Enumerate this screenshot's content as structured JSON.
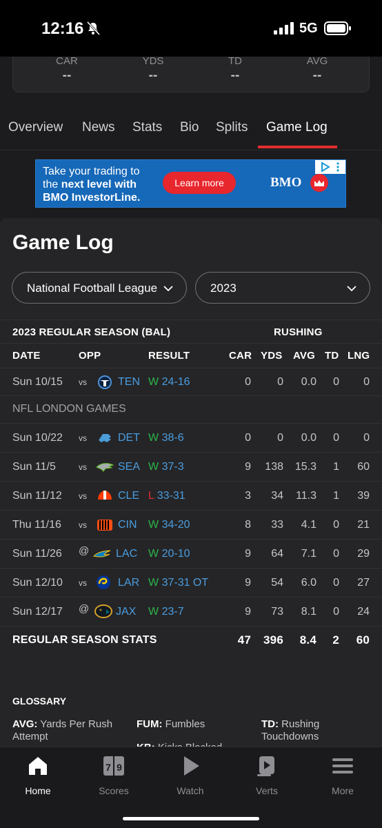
{
  "status_bar": {
    "time": "12:16",
    "network": "5G"
  },
  "stat_summary": [
    {
      "label": "CAR",
      "value": "--"
    },
    {
      "label": "YDS",
      "value": "--"
    },
    {
      "label": "TD",
      "value": "--"
    },
    {
      "label": "AVG",
      "value": "--"
    }
  ],
  "tabs": [
    {
      "label": "Overview"
    },
    {
      "label": "News"
    },
    {
      "label": "Stats"
    },
    {
      "label": "Bio"
    },
    {
      "label": "Splits"
    },
    {
      "label": "Game Log",
      "active": true
    }
  ],
  "ad": {
    "line1": "Take your trading to",
    "line2_pre": "the ",
    "line2_bold": "next level with",
    "line3": "BMO InvestorLine.",
    "button": "Learn more",
    "brand": "BMO"
  },
  "game_log": {
    "title": "Game Log",
    "league_select": "National Football League",
    "season_select": "2023",
    "section_header": "2023 REGULAR SEASON (BAL)",
    "group_header": "RUSHING",
    "columns": [
      "DATE",
      "OPP",
      "RESULT",
      "CAR",
      "YDS",
      "AVG",
      "TD",
      "LNG"
    ],
    "games": [
      {
        "date": "Sun 10/15",
        "loc": "vs",
        "team": "TEN",
        "wl": "W",
        "score": "24-16",
        "car": "0",
        "yds": "0",
        "avg": "0.0",
        "td": "0",
        "lng": "0"
      },
      {
        "date": "Sun 10/22",
        "loc": "vs",
        "team": "DET",
        "wl": "W",
        "score": "38-6",
        "car": "0",
        "yds": "0",
        "avg": "0.0",
        "td": "0",
        "lng": "0"
      },
      {
        "date": "Sun 11/5",
        "loc": "vs",
        "team": "SEA",
        "wl": "W",
        "score": "37-3",
        "car": "9",
        "yds": "138",
        "avg": "15.3",
        "td": "1",
        "lng": "60"
      },
      {
        "date": "Sun 11/12",
        "loc": "vs",
        "team": "CLE",
        "wl": "L",
        "score": "33-31",
        "car": "3",
        "yds": "34",
        "avg": "11.3",
        "td": "1",
        "lng": "39"
      },
      {
        "date": "Thu 11/16",
        "loc": "vs",
        "team": "CIN",
        "wl": "W",
        "score": "34-20",
        "car": "8",
        "yds": "33",
        "avg": "4.1",
        "td": "0",
        "lng": "21"
      },
      {
        "date": "Sun 11/26",
        "loc": "@",
        "team": "LAC",
        "wl": "W",
        "score": "20-10",
        "car": "9",
        "yds": "64",
        "avg": "7.1",
        "td": "0",
        "lng": "29"
      },
      {
        "date": "Sun 12/10",
        "loc": "vs",
        "team": "LAR",
        "wl": "W",
        "score": "37-31 OT",
        "car": "9",
        "yds": "54",
        "avg": "6.0",
        "td": "0",
        "lng": "27"
      },
      {
        "date": "Sun 12/17",
        "loc": "@",
        "team": "JAX",
        "wl": "W",
        "score": "23-7",
        "car": "9",
        "yds": "73",
        "avg": "8.1",
        "td": "0",
        "lng": "24"
      }
    ],
    "subheader": "NFL LONDON GAMES",
    "totals": {
      "label": "REGULAR SEASON STATS",
      "car": "47",
      "yds": "396",
      "avg": "8.4",
      "td": "2",
      "lng": "60"
    }
  },
  "glossary": {
    "title": "GLOSSARY",
    "items": [
      {
        "term": "AVG:",
        "def1": "Yards Per Rush",
        "def2": "Attempt"
      },
      {
        "term": "FUM:",
        "def1": "Fumbles",
        "def2": ""
      },
      {
        "term": "TD:",
        "def1": "Rushing",
        "def2": "Touchdowns"
      },
      {
        "term": "KB:",
        "def1": "Kicks Blocked",
        "def2": ""
      }
    ]
  },
  "bottom_nav": [
    {
      "label": "Home",
      "icon": "home-icon",
      "active": true
    },
    {
      "label": "Scores",
      "icon": "scores-icon"
    },
    {
      "label": "Watch",
      "icon": "play-icon"
    },
    {
      "label": "Verts",
      "icon": "verts-icon"
    },
    {
      "label": "More",
      "icon": "menu-icon"
    }
  ],
  "colors": {
    "accent": "#e22d2d",
    "win": "#2bb54a",
    "loss": "#e22d2d",
    "link": "#4a9de0"
  }
}
